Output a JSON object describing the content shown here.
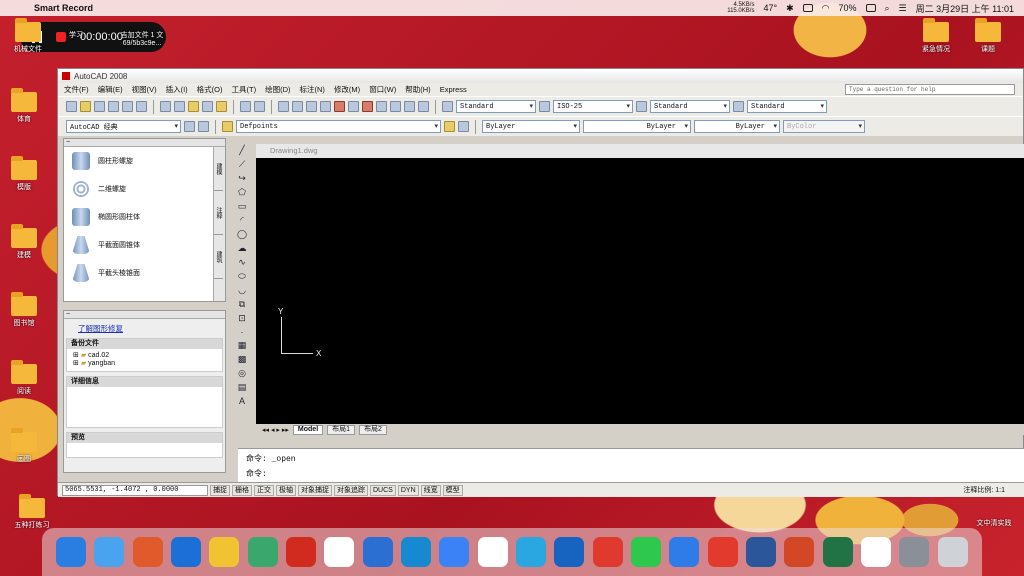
{
  "menubar": {
    "app_name": "Smart Record",
    "net_up": "4.5KB/s",
    "net_down": "115.0KB/s",
    "temperature": "47°",
    "battery": "70%",
    "datetime": "周二 3月29日 上午 11:01"
  },
  "recorder": {
    "timer": "00:00:00"
  },
  "desktop_icons": [
    {
      "label": "机械文件"
    },
    {
      "label": "学习"
    },
    {
      "label": "吉加文件 1 文 69/5b3c9e..."
    },
    {
      "label": "体育"
    },
    {
      "label": "模版"
    },
    {
      "label": "建模"
    },
    {
      "label": "图书馆"
    },
    {
      "label": "阅读"
    },
    {
      "label": "画图"
    },
    {
      "label": "五种打练习"
    },
    {
      "label": "紧急情况"
    },
    {
      "label": "课题"
    },
    {
      "label": "文中清实践"
    }
  ],
  "autocad": {
    "title": "AutoCAD 2008",
    "menu": [
      "文件(F)",
      "编辑(E)",
      "视图(V)",
      "插入(I)",
      "格式(O)",
      "工具(T)",
      "绘图(D)",
      "标注(N)",
      "修改(M)",
      "窗口(W)",
      "帮助(H)",
      "Express"
    ],
    "help_placeholder": "Type a question for help",
    "styles": {
      "text_style": "Standard",
      "dim_style": "ISO-25",
      "table_style": "Standard",
      "multileader_style": "Standard"
    },
    "workspace": "AutoCAD 经典",
    "layer": "Defpoints",
    "color": "ByLayer",
    "linetype": "ByLayer",
    "lineweight": "ByLayer",
    "plotstyle": "ByColor",
    "tool_palette": {
      "items": [
        "圆柱形螺旋",
        "二维螺旋",
        "椭圆形圆柱体",
        "平截面圆锥体",
        "平截头棱锥面"
      ],
      "tabs": [
        "建模",
        "注释",
        "建筑"
      ]
    },
    "drawing_recovery": {
      "link": "了解图形修复",
      "backup_header": "备份文件",
      "backup_files": [
        "cad.02",
        "yangban"
      ],
      "details_header": "详细信息",
      "preview_header": "预览"
    },
    "drawing_tab": "Drawing1.dwg",
    "ucs": {
      "x": "X",
      "y": "Y"
    },
    "layout_tabs": [
      "Model",
      "布局1",
      "布局2"
    ],
    "command_lines": [
      "命令: _open",
      "命令:"
    ],
    "status": {
      "coords": "5065.5531, -1.4072 , 0.0000",
      "buttons": [
        "捕捉",
        "栅格",
        "正交",
        "极轴",
        "对象捕捉",
        "对象追踪",
        "DUCS",
        "DYN",
        "线宽",
        "模型"
      ],
      "annotation_scale": "注释比例: 1:1"
    }
  },
  "dock": [
    {
      "name": "Finder",
      "color": "#2a7de1"
    },
    {
      "name": "Folder",
      "color": "#4aa3ee"
    },
    {
      "name": "Video",
      "color": "#e05a2b"
    },
    {
      "name": "App",
      "color": "#1d6fd8"
    },
    {
      "name": "Player",
      "color": "#f1c232"
    },
    {
      "name": "A",
      "color": "#3aa76d"
    },
    {
      "name": "Flash",
      "color": "#d12b1f"
    },
    {
      "name": "M",
      "color": "#ffffff"
    },
    {
      "name": "Window",
      "color": "#2b6fd3"
    },
    {
      "name": "Edge",
      "color": "#1689d1"
    },
    {
      "name": "Globe",
      "color": "#3b82f6"
    },
    {
      "name": "Pitaya",
      "color": "#ffffff"
    },
    {
      "name": "Arc",
      "color": "#2aa7e0"
    },
    {
      "name": "Aa",
      "color": "#1664c0"
    },
    {
      "name": "NetEase",
      "color": "#e03a2f"
    },
    {
      "name": "WeChat",
      "color": "#2dc84d"
    },
    {
      "name": "Star",
      "color": "#2f7be8"
    },
    {
      "name": "WPS",
      "color": "#e23b2e"
    },
    {
      "name": "Word",
      "color": "#2b579a"
    },
    {
      "name": "PowerPoint",
      "color": "#d24726"
    },
    {
      "name": "Excel",
      "color": "#217346"
    },
    {
      "name": "Windows",
      "color": "#ffffff"
    },
    {
      "name": "Zoom",
      "color": "#8a8f98"
    },
    {
      "name": "Trash",
      "color": "#cfd3d8"
    }
  ]
}
